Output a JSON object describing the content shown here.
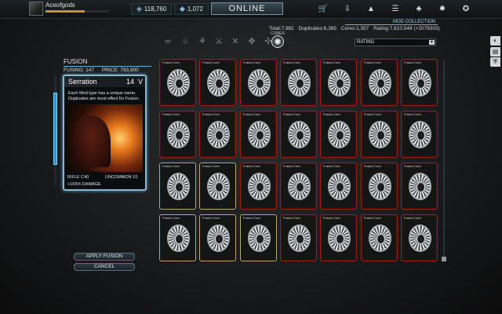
{
  "topbar": {
    "username": "Aceofgods",
    "xp_progress": 0.62,
    "credits": "118,760",
    "platinum": "1,072",
    "status_button": "ONLINE",
    "icons": [
      "market-icon",
      "inventory-icon",
      "foundry-icon",
      "codex-icon",
      "alerts-icon",
      "settings-icon",
      "exit-icon"
    ]
  },
  "header": {
    "section_title": "MOD COLLECTION",
    "stats": {
      "total": "Total:7,982",
      "duplicates": "Duplicates:6,385",
      "cores": "Cores:1,357",
      "rating": "Rating:7,610,548 (+2078303)"
    },
    "cores_label": "CORES",
    "sort_value": "RATING",
    "categories": [
      "infinity-icon",
      "tri-loop-icon",
      "feather-icon",
      "blade-icon",
      "crossed-blades-icon",
      "drone-icon",
      "fusion-core-icon"
    ]
  },
  "fusion": {
    "title": "FUSION",
    "fusing": "FUSING: 147",
    "price": "PRICE: 793,800",
    "apply_label": "APPLY FUSION",
    "cancel_label": "CANCEL"
  },
  "mod_card": {
    "name": "Serration",
    "drain": "14",
    "polarity": "V",
    "tooltip": "Each Mod type has a unique name. Duplicates are most effect for Fusion.",
    "type_line": "RIFLE C40",
    "effect": "+165% DAMAGE",
    "rarity": "UNCOMMON 10"
  },
  "grid": {
    "card_title": "Fusion Core",
    "rows": [
      [
        "red",
        "red",
        "red",
        "red",
        "red",
        "red",
        "red"
      ],
      [
        "red",
        "red",
        "red",
        "red",
        "red",
        "red",
        "red"
      ],
      [
        "gold",
        "gold",
        "red",
        "red",
        "red",
        "red",
        "red"
      ],
      [
        "gold",
        "gold",
        "gold",
        "red",
        "red",
        "red",
        "red"
      ]
    ]
  },
  "side_tabs": [
    "chat-icon",
    "library-icon",
    "shield-icon"
  ],
  "colors": {
    "accent_blue": "#5fb4db",
    "card_red": "#9a1e1a",
    "card_gold": "#b8a77a"
  }
}
